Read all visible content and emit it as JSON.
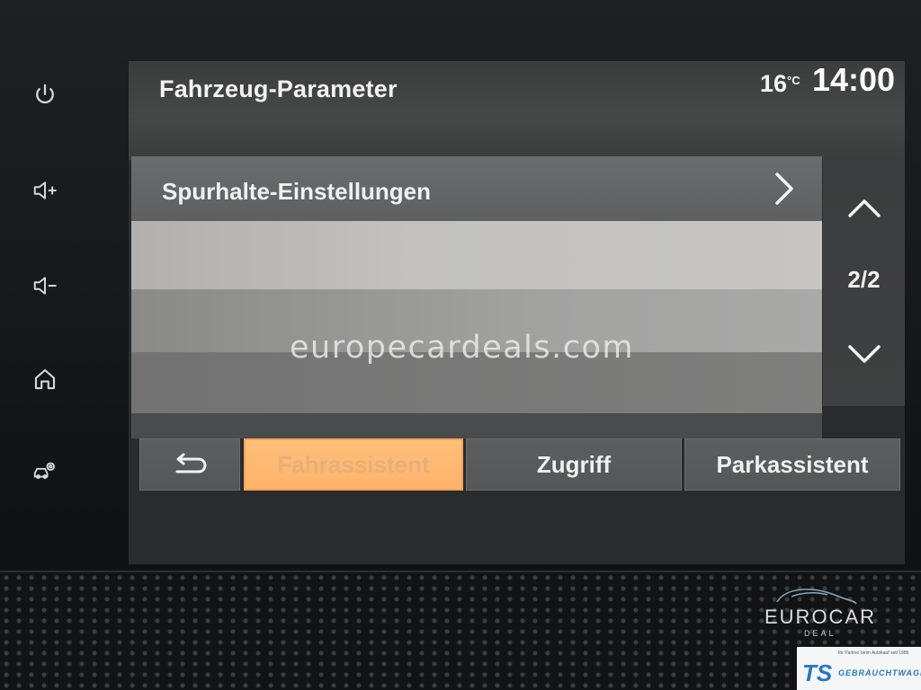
{
  "header": {
    "title": "Fahrzeug-Parameter",
    "temperature": "16",
    "temperature_unit": "°C",
    "time": "14:00"
  },
  "side_buttons": [
    {
      "name": "power-icon"
    },
    {
      "name": "volume-up-icon"
    },
    {
      "name": "volume-down-icon"
    },
    {
      "name": "home-icon"
    },
    {
      "name": "vehicle-settings-icon"
    }
  ],
  "list": {
    "items": [
      {
        "label": "Spurhalte-Einstellungen",
        "icon": "chevron-right-icon"
      },
      {
        "label": ""
      },
      {
        "label": ""
      },
      {
        "label": ""
      }
    ]
  },
  "scroll": {
    "page": "2/2",
    "up_icon": "chevron-up-icon",
    "down_icon": "chevron-down-icon"
  },
  "tabs": {
    "back_icon": "return-arrow-icon",
    "items": [
      {
        "label": "Fahrassistent",
        "active": true
      },
      {
        "label": "Zugriff",
        "active": false
      },
      {
        "label": "Parkassistent",
        "active": false
      }
    ]
  },
  "watermark": "europecardeals.com",
  "logos": {
    "eurocar_brand": "EUROCAR",
    "eurocar_sub": "DEAL",
    "ts_tagline": "Ihr Partner beim Autokauf seit 1986",
    "ts_mark": "TS",
    "ts_sub": "GEBRAUCHTWAGEN"
  },
  "colors": {
    "active_tab": "#ffb36a",
    "screen_bg": "#2a2b2c"
  }
}
